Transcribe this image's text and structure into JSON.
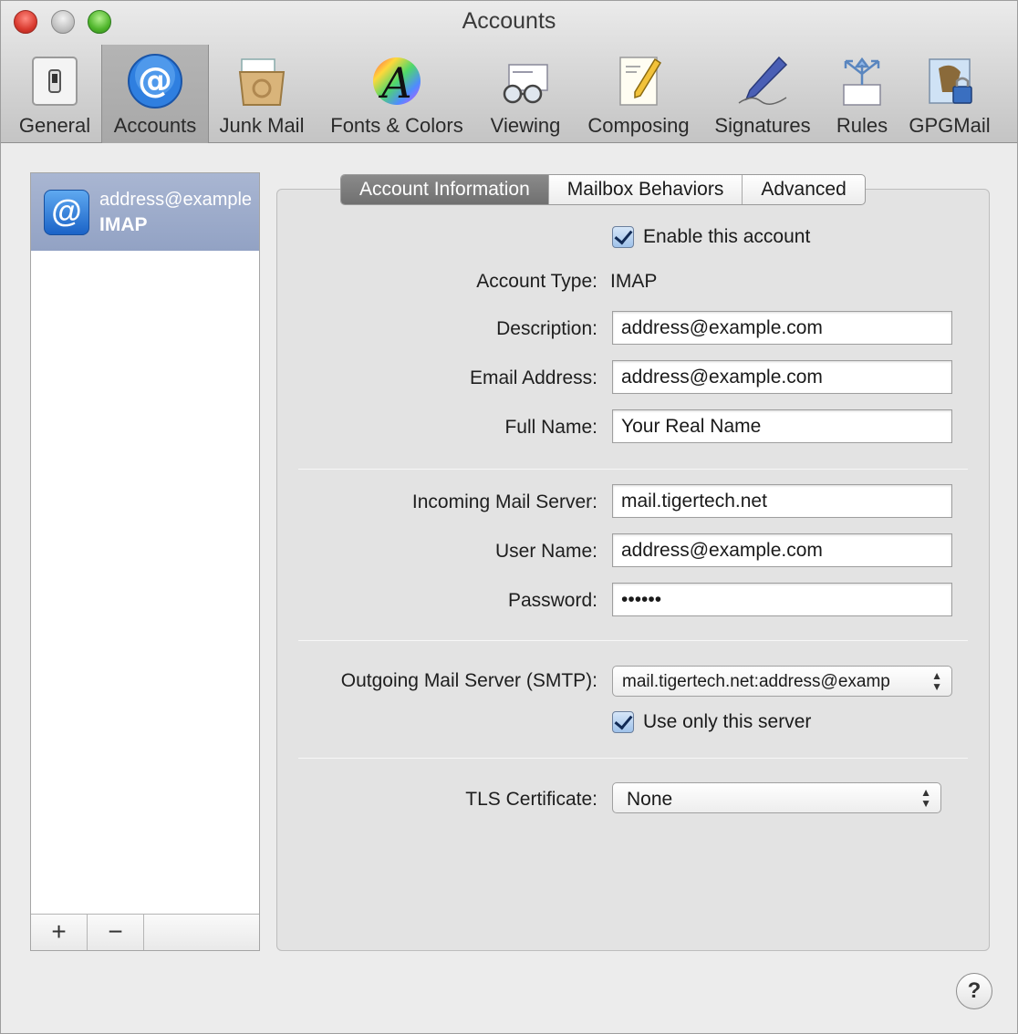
{
  "window": {
    "title": "Accounts"
  },
  "toolbar": {
    "items": [
      {
        "label": "General",
        "icon": "switch-icon"
      },
      {
        "label": "Accounts",
        "icon": "at-sign-icon"
      },
      {
        "label": "Junk Mail",
        "icon": "junk-mail-icon"
      },
      {
        "label": "Fonts & Colors",
        "icon": "fonts-colors-icon"
      },
      {
        "label": "Viewing",
        "icon": "viewing-icon"
      },
      {
        "label": "Composing",
        "icon": "composing-icon"
      },
      {
        "label": "Signatures",
        "icon": "pen-icon"
      },
      {
        "label": "Rules",
        "icon": "rules-icon"
      },
      {
        "label": "GPGMail",
        "icon": "gpgmail-icon"
      }
    ],
    "selected": "Accounts"
  },
  "sidebar": {
    "account": {
      "email": "address@example",
      "type": "IMAP",
      "icon_glyph": "@"
    },
    "add_label": "+",
    "remove_label": "−"
  },
  "tabs": [
    "Account Information",
    "Mailbox Behaviors",
    "Advanced"
  ],
  "form": {
    "enable_label": "Enable this account",
    "account_type_label": "Account Type:",
    "account_type_value": "IMAP",
    "description_label": "Description:",
    "description_value": "address@example.com",
    "email_label": "Email Address:",
    "email_value": "address@example.com",
    "fullname_label": "Full Name:",
    "fullname_value": "Your Real Name",
    "incoming_label": "Incoming Mail Server:",
    "incoming_value": "mail.tigertech.net",
    "username_label": "User Name:",
    "username_value": "address@example.com",
    "password_label": "Password:",
    "password_value": "••••••",
    "smtp_label": "Outgoing Mail Server (SMTP):",
    "smtp_value": "mail.tigertech.net:address@examp",
    "use_only_label": "Use only this server",
    "tls_label": "TLS Certificate:",
    "tls_value": "None"
  },
  "help": {
    "label": "?"
  },
  "colors": {
    "selection": "#a0afcd",
    "accent": "#1b63c7",
    "close": "#d93a2f",
    "minimize": "#c2c2c2",
    "zoom": "#4fb52b"
  }
}
